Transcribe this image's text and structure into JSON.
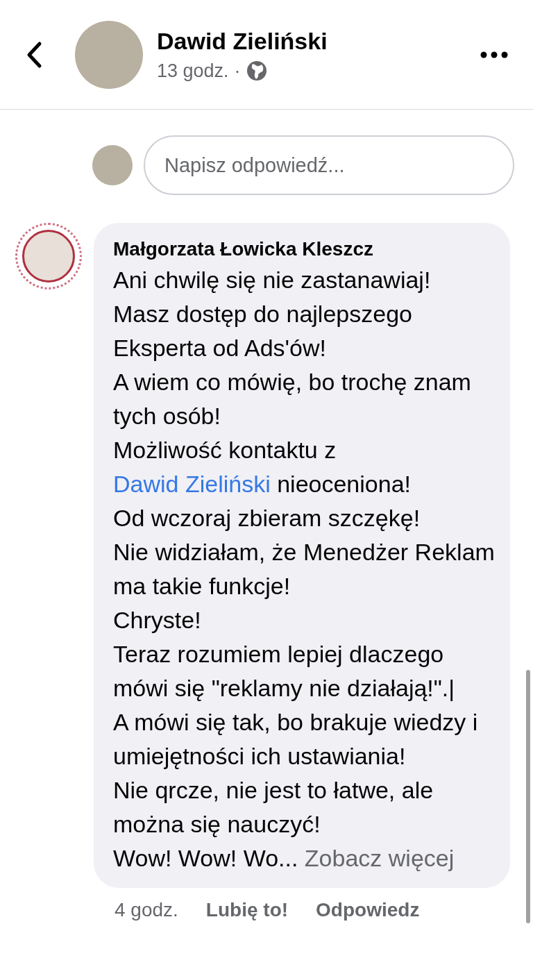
{
  "header": {
    "author": "Dawid Zieliński",
    "time": "13 godz.",
    "separator": "·"
  },
  "reply_field": {
    "placeholder": "Napisz odpowiedź..."
  },
  "comment": {
    "author": "Małgorzata Łowicka Kleszcz",
    "paragraphs": [
      [
        {
          "kind": "text",
          "text": "Ani chwilę się nie zastanawiaj!"
        }
      ],
      [
        {
          "kind": "text",
          "text": "Masz dostęp do najlepszego Eksperta od Ads'ów!"
        }
      ],
      [
        {
          "kind": "text",
          "text": "A wiem co mówię, bo trochę znam tych osób!"
        }
      ],
      [
        {
          "kind": "text",
          "text": "Możliwość kontaktu z "
        },
        {
          "kind": "mention",
          "text": "Dawid Zieliński"
        },
        {
          "kind": "text",
          "text": " nieoceniona!"
        }
      ],
      [
        {
          "kind": "text",
          "text": "Od wczoraj zbieram szczękę!"
        }
      ],
      [
        {
          "kind": "text",
          "text": "Nie widziałam, że Menedżer Reklam ma takie funkcje!"
        }
      ],
      [
        {
          "kind": "text",
          "text": "Chryste!"
        }
      ],
      [
        {
          "kind": "text",
          "text": "Teraz rozumiem lepiej dlaczego mówi się \"reklamy nie działają!\".|"
        }
      ],
      [
        {
          "kind": "text",
          "text": "A mówi się tak, bo brakuje wiedzy i umiejętności ich ustawiania!"
        }
      ],
      [
        {
          "kind": "text",
          "text": "Nie qrcze, nie jest to łatwe, ale można się nauczyć!"
        }
      ],
      [
        {
          "kind": "text",
          "text": "Wow! Wow! Wo... "
        },
        {
          "kind": "more",
          "text": "Zobacz więcej"
        }
      ]
    ],
    "time": "4 godz.",
    "like": "Lubię to!",
    "reply": "Odpowiedz"
  }
}
